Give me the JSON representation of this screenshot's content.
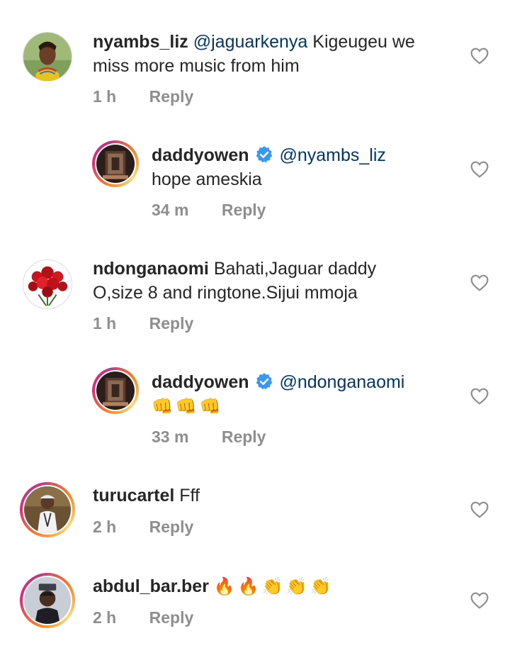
{
  "colors": {
    "text": "#262626",
    "mention": "#00376b",
    "meta": "#8e8e8e",
    "verified": "#3897f0"
  },
  "comments": [
    {
      "username": "nyambs_liz",
      "mention": "@jaguarkenya",
      "text_line1": "Kigeugeu we",
      "text_line2": "miss more music from him",
      "time": "1 h",
      "reply_label": "Reply",
      "avatar_icon": "woman-traditional-beads-avatar"
    },
    {
      "username": "daddyowen",
      "verified": true,
      "mention": "@nyambs_liz",
      "text_line2": "hope ameskia",
      "time": "34 m",
      "reply_label": "Reply",
      "avatar_icon": "album-art-avatar"
    },
    {
      "username": "ndonganaomi",
      "text_line1": "Bahati,Jaguar daddy",
      "text_line2": "O,size 8 and ringtone.Sijui mmoja",
      "time": "1 h",
      "reply_label": "Reply",
      "avatar_icon": "red-roses-avatar"
    },
    {
      "username": "daddyowen",
      "verified": true,
      "mention": "@ndonganaomi",
      "emojis": [
        "👊",
        "👊",
        "👊"
      ],
      "time": "33 m",
      "reply_label": "Reply",
      "avatar_icon": "album-art-avatar"
    },
    {
      "username": "turucartel",
      "text_line1": "Fff",
      "time": "2 h",
      "reply_label": "Reply",
      "avatar_icon": "man-outdoors-avatar"
    },
    {
      "username": "abdul_bar.ber",
      "emojis": [
        "🔥",
        "🔥",
        "👏",
        "👏",
        "👏"
      ],
      "time": "2 h",
      "reply_label": "Reply",
      "avatar_icon": "man-haircut-avatar"
    }
  ]
}
